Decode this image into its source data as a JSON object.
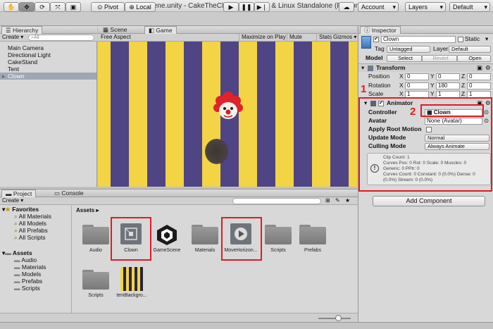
{
  "window": {
    "title": "GameScene.unity - CakeTheClown - PC, Mac & Linux Standalone (Personal)"
  },
  "toolbar": {
    "pivot": "Pivot",
    "local": "Local",
    "account": "Account",
    "layers": "Layers",
    "layout": "Default"
  },
  "hierarchy": {
    "tab": "Hierarchy",
    "create": "Create",
    "search_placeholder": "All",
    "items": [
      "Main Camera",
      "Directional Light",
      "CakeStand",
      "Tent",
      "Clown"
    ]
  },
  "scene": {
    "tab": "Scene"
  },
  "game": {
    "tab": "Game",
    "aspect": "Free Aspect",
    "maximize": "Maximize on Play",
    "mute": "Mute audio",
    "stats": "Stats",
    "gizmos": "Gizmos",
    "colors": {
      "yellow": "#f2d445",
      "purple": "#4f4585"
    }
  },
  "inspector": {
    "tab": "Inspector",
    "object_name": "Clown",
    "static": "Static",
    "tag_label": "Tag",
    "tag_value": "Untagged",
    "layer_label": "Layer",
    "layer_value": "Default",
    "model_label": "Model",
    "select": "Select",
    "revert": "Revert",
    "open": "Open",
    "transform": {
      "title": "Transform",
      "position_label": "Position",
      "rotation_label": "Rotation",
      "scale_label": "Scale",
      "x": "X",
      "y": "Y",
      "z": "Z",
      "position": [
        "0",
        "0",
        "0"
      ],
      "rotation": [
        "0",
        "180",
        "0"
      ],
      "scale": [
        "1",
        "1",
        "1"
      ]
    },
    "animator": {
      "title": "Animator",
      "controller_label": "Controller",
      "controller_value": "Clown",
      "avatar_label": "Avatar",
      "avatar_value": "None (Avatar)",
      "apply_root_label": "Apply Root Motion",
      "update_mode_label": "Update Mode",
      "update_mode_value": "Normal",
      "culling_label": "Culling Mode",
      "culling_value": "Always Animate",
      "info": [
        "Clip Count: 1",
        "Curves Pos: 0 Rot: 0 Scale: 0 Muscles: 0",
        "Generic: 0 PPtr: 0",
        "Curves Count: 0 Constant: 0 (0.0%) Dense: 0",
        "(0.0%) Stream: 0 (0.0%)"
      ]
    },
    "add_component": "Add Component"
  },
  "annotations": {
    "one": "1",
    "two": "2"
  },
  "project": {
    "tab": "Project",
    "console_tab": "Console",
    "create": "Create",
    "favorites": {
      "title": "Favorites",
      "items": [
        "All Materials",
        "All Models",
        "All Prefabs",
        "All Scripts"
      ]
    },
    "assets_tree": {
      "title": "Assets",
      "items": [
        "Audio",
        "Materials",
        "Models",
        "Prefabs",
        "Scripts"
      ]
    },
    "breadcrumb": "Assets",
    "assets": [
      "Audio",
      "Clown",
      "GameScene",
      "Materials",
      "MoveHorizon...",
      "Scripts",
      "Prefabs",
      "Scripts",
      "tentBackgro..."
    ]
  }
}
